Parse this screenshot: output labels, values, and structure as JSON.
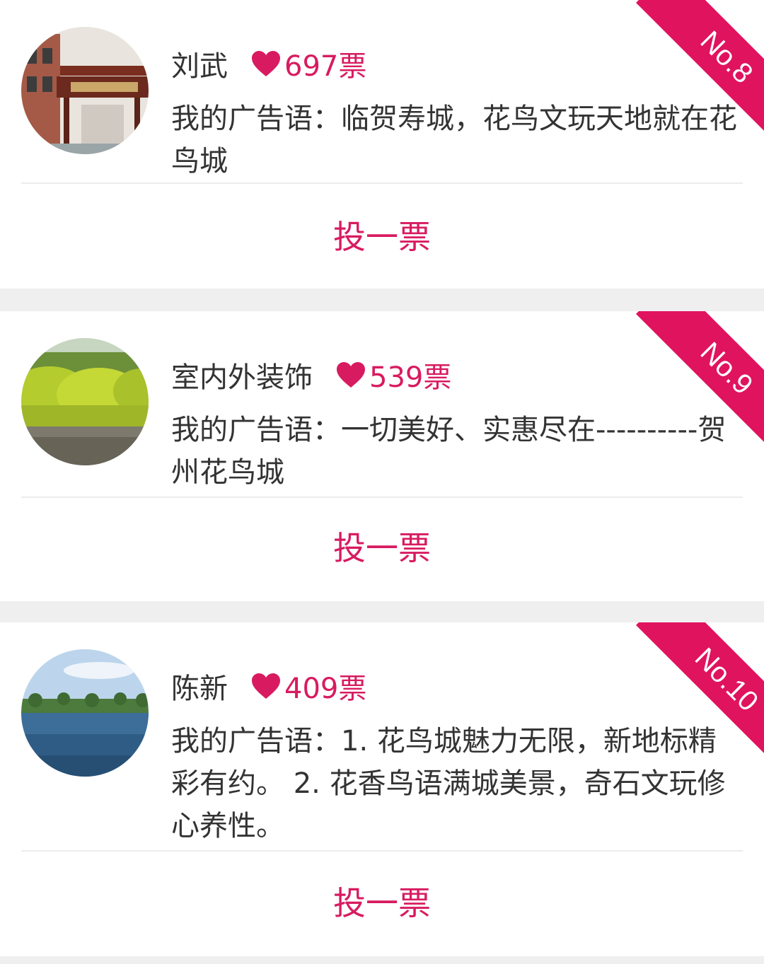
{
  "entries": [
    {
      "rank": "No.8",
      "name": "刘武",
      "votes": "697票",
      "slogan": "我的广告语：临贺寿城，花鸟文玩天地就在花鸟城",
      "vote_button": "投一票"
    },
    {
      "rank": "No.9",
      "name": "室内外装饰",
      "votes": "539票",
      "slogan": "我的广告语：一切美好、实惠尽在----------贺州花鸟城",
      "vote_button": "投一票"
    },
    {
      "rank": "No.10",
      "name": "陈新",
      "votes": "409票",
      "slogan": "我的广告语：1. 花鸟城魅力无限，新地标精彩有约。 2. 花香鸟语满城美景，奇石文玩修心养性。",
      "vote_button": "投一票"
    }
  ],
  "colors": {
    "accent": "#d81b60",
    "ribbon": "#e0135f",
    "separator": "#efefef"
  },
  "icons": {
    "vote_icon": "heart-icon"
  }
}
